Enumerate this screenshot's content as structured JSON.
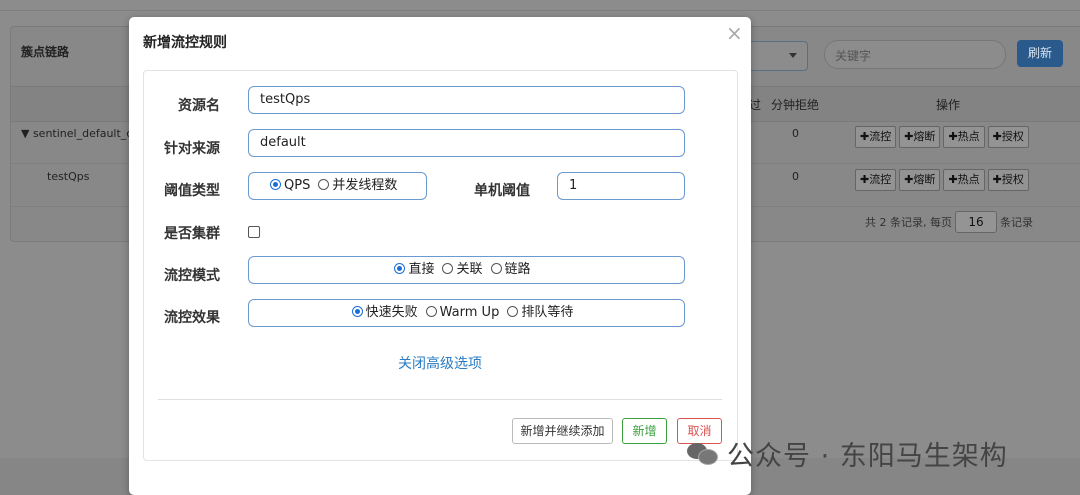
{
  "background": {
    "panel_title": "簇点链路",
    "search_placeholder": "关键字",
    "refresh_label": "刷新",
    "table_headers": {
      "partial": "过",
      "reject": "分钟拒绝",
      "actions": "操作"
    },
    "rows": [
      {
        "name": "▼ sentinel_default_co",
        "count": "0",
        "buttons": [
          "✚流控",
          "✚熔断",
          "✚热点",
          "✚授权"
        ]
      },
      {
        "name": "testQps",
        "count": "0",
        "buttons": [
          "✚流控",
          "✚熔断",
          "✚热点",
          "✚授权"
        ]
      }
    ],
    "pager": {
      "prefix": "共 2 条记录, 每页",
      "page_size": "16",
      "suffix": "条记录"
    }
  },
  "modal": {
    "title": "新增流控规则",
    "close": "×",
    "labels": {
      "resource": "资源名",
      "origin": "针对来源",
      "threshold_type": "阈值类型",
      "single_threshold": "单机阈值",
      "cluster": "是否集群",
      "mode": "流控模式",
      "effect": "流控效果"
    },
    "resource_value": "testQps",
    "origin_value": "default",
    "threshold_value": "1",
    "threshold_type_options": [
      "QPS",
      "并发线程数"
    ],
    "mode_options": [
      "直接",
      "关联",
      "链路"
    ],
    "effect_options": [
      "快速失败",
      "Warm Up",
      "排队等待"
    ],
    "advanced_link": "关闭高级选项",
    "buttons": {
      "add_continue": "新增并继续添加",
      "add": "新增",
      "cancel": "取消"
    }
  },
  "watermark": "公众号 · 东阳马生架构"
}
